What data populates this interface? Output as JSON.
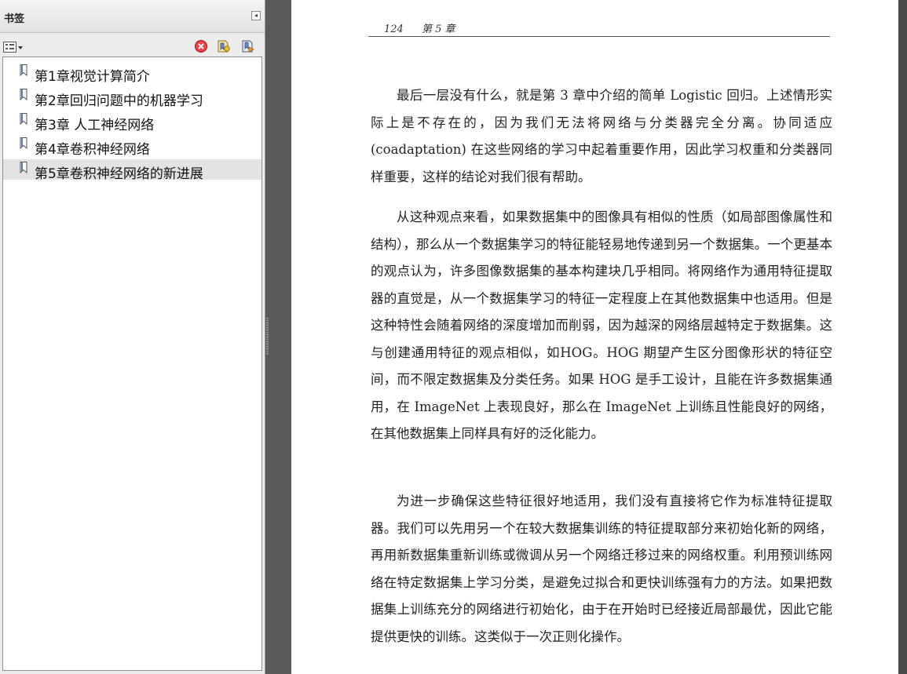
{
  "panel": {
    "title": "书签",
    "collapse_glyph": "◂",
    "toolbar": {
      "options_icon": "options-menu-icon",
      "delete_icon": "delete-bookmark-icon",
      "new_icon": "new-bookmark-icon",
      "expand_icon": "expand-bookmark-icon"
    },
    "bookmarks": [
      {
        "label": "第1章视觉计算简介",
        "selected": false
      },
      {
        "label": "第2章回归问题中的机器学习",
        "selected": false
      },
      {
        "label": "第3章 人工神经网络",
        "selected": false
      },
      {
        "label": "第4章卷积神经网络",
        "selected": false
      },
      {
        "label": "第5章卷积神经网络的新进展",
        "selected": true
      }
    ]
  },
  "page": {
    "page_number": "124",
    "chapter": "第 5 章",
    "paragraphs": [
      "最后一层没有什么，就是第 3 章中介绍的简单 Logistic 回归。上述情形实际上是不存在的，因为我们无法将网络与分类器完全分离。协同适应(coadaptation) 在这些网络的学习中起着重要作用，因此学习权重和分类器同样重要，这样的结论对我们很有帮助。",
      "从这种观点来看，如果数据集中的图像具有相似的性质（如局部图像属性和结构），那么从一个数据集学习的特征能轻易地传递到另一个数据集。一个更基本的观点认为，许多图像数据集的基本构建块几乎相同。将网络作为通用特征提取器的直觉是，从一个数据集学习的特征一定程度上在其他数据集中也适用。但是这种特性会随着网络的深度增加而削弱，因为越深的网络层越特定于数据集。这与创建通用特征的观点相似，如HOG。HOG 期望产生区分图像形状的特征空间，而不限定数据集及分类任务。如果 HOG 是手工设计，且能在许多数据集通用，在 ImageNet 上表现良好，那么在 ImageNet 上训练且性能良好的网络，在其他数据集上同样具有好的泛化能力。",
      "为进一步确保这些特征很好地适用，我们没有直接将它作为标准特征提取器。我们可以先用另一个在较大数据集训练的特征提取部分来初始化新的网络，再用新数据集重新训练或微调从另一个网络迁移过来的网络权重。利用预训练网络在特定数据集上学习分类，是避免过拟合和更快训练强有力的方法。如果把数据集上训练充分的网络进行初始化，由于在开始时已经接近局部最优，因此它能提供更快的训练。这类似于一次正则化操作。"
    ]
  }
}
